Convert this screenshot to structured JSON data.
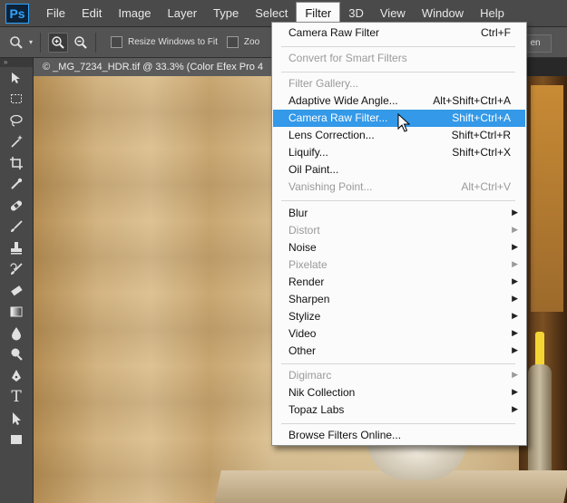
{
  "app": {
    "logo": "Ps"
  },
  "menubar": [
    "File",
    "Edit",
    "Image",
    "Layer",
    "Type",
    "Select",
    "Filter",
    "3D",
    "View",
    "Window",
    "Help"
  ],
  "options": {
    "resize_label": "Resize Windows to Fit",
    "zoom_label": "Zoo",
    "screen_button": "en"
  },
  "document": {
    "tab_title": "© _MG_7234_HDR.tif @ 33.3% (Color Efex Pro 4"
  },
  "filter_menu": {
    "items": [
      {
        "label": "Camera Raw Filter",
        "shortcut": "Ctrl+F"
      },
      {
        "label": "Convert for Smart Filters",
        "shortcut": ""
      },
      {
        "label": "Filter Gallery...",
        "shortcut": ""
      },
      {
        "label": "Adaptive Wide Angle...",
        "shortcut": "Alt+Shift+Ctrl+A"
      },
      {
        "label": "Camera Raw Filter...",
        "shortcut": "Shift+Ctrl+A"
      },
      {
        "label": "Lens Correction...",
        "shortcut": "Shift+Ctrl+R"
      },
      {
        "label": "Liquify...",
        "shortcut": "Shift+Ctrl+X"
      },
      {
        "label": "Oil Paint...",
        "shortcut": ""
      },
      {
        "label": "Vanishing Point...",
        "shortcut": "Alt+Ctrl+V"
      },
      {
        "label": "Blur",
        "shortcut": ""
      },
      {
        "label": "Distort",
        "shortcut": ""
      },
      {
        "label": "Noise",
        "shortcut": ""
      },
      {
        "label": "Pixelate",
        "shortcut": ""
      },
      {
        "label": "Render",
        "shortcut": ""
      },
      {
        "label": "Sharpen",
        "shortcut": ""
      },
      {
        "label": "Stylize",
        "shortcut": ""
      },
      {
        "label": "Video",
        "shortcut": ""
      },
      {
        "label": "Other",
        "shortcut": ""
      },
      {
        "label": "Digimarc",
        "shortcut": ""
      },
      {
        "label": "Nik Collection",
        "shortcut": ""
      },
      {
        "label": "Topaz Labs",
        "shortcut": ""
      },
      {
        "label": "Browse Filters Online...",
        "shortcut": ""
      }
    ]
  },
  "colors": {
    "highlight": "#3399e8",
    "menubar": "#4a4a4a",
    "ps_blue": "#2fa3ff"
  },
  "icons": [
    "zoom-tool-icon",
    "zoom-in-icon",
    "zoom-out-icon",
    "move-tool-icon",
    "marquee-icon",
    "lasso-icon",
    "magic-wand-icon",
    "crop-icon",
    "eyedropper-icon",
    "healing-icon",
    "brush-icon",
    "stamp-icon",
    "history-brush-icon",
    "eraser-icon",
    "gradient-icon",
    "blur-icon",
    "dodge-icon",
    "pen-icon",
    "type-icon",
    "path-select-icon",
    "mouse-cursor-icon"
  ]
}
